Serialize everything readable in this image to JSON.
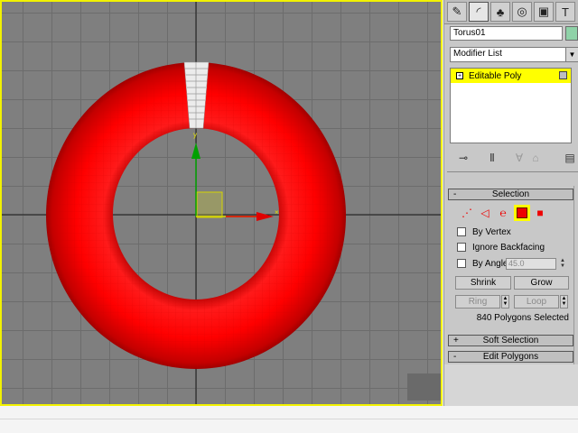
{
  "app": {
    "accent": "#f2f200",
    "object_color": "#ff0000"
  },
  "command_panel": {
    "tabs": [
      {
        "icon": "create-icon",
        "glyph": "✎"
      },
      {
        "icon": "modify-icon",
        "glyph": "◜"
      },
      {
        "icon": "hierarchy-icon",
        "glyph": "♣"
      },
      {
        "icon": "motion-icon",
        "glyph": "◎"
      },
      {
        "icon": "display-icon",
        "glyph": "▣"
      },
      {
        "icon": "utilities-icon",
        "glyph": "T"
      }
    ],
    "object_name": "Torus01",
    "object_color_swatch": "#8fd2a8",
    "modifier_list_label": "Modifier List",
    "modifier_stack": [
      {
        "label": "Editable Poly",
        "expand": "+"
      }
    ]
  },
  "selection": {
    "title": "Selection",
    "collapse_sign": "-",
    "by_vertex": "By Vertex",
    "ignore_backfacing": "Ignore Backfacing",
    "by_angle": "By Angle:",
    "angle_value": "45.0",
    "shrink": "Shrink",
    "grow": "Grow",
    "ring": "Ring",
    "loop": "Loop",
    "status": "840 Polygons Selected"
  },
  "soft_selection": {
    "title": "Soft Selection",
    "sign": "+"
  },
  "edit_polygons": {
    "title": "Edit Polygons",
    "sign": "-"
  }
}
